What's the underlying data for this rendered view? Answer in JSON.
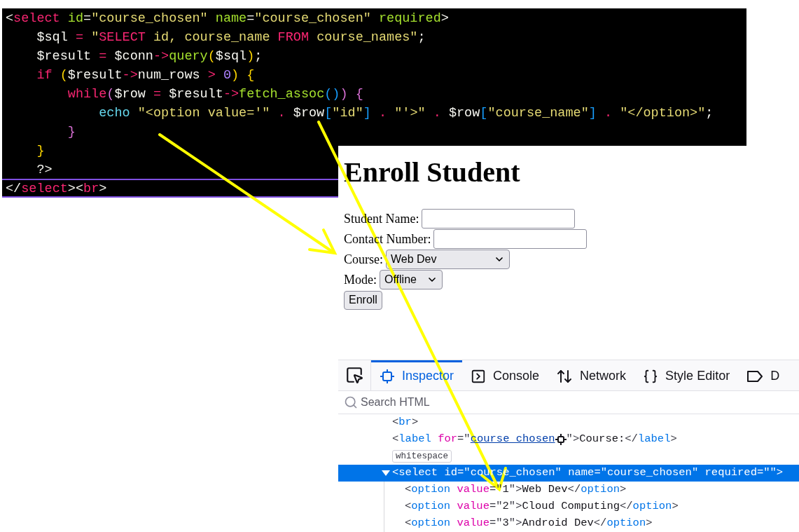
{
  "code_editor": {
    "lines": [
      {
        "current": false,
        "tokens": [
          {
            "kind": "plain",
            "text": "<"
          },
          {
            "kind": "tag",
            "text": "select"
          },
          {
            "kind": "attr",
            "text": " id"
          },
          {
            "kind": "plain",
            "text": "="
          },
          {
            "kind": "string",
            "text": "\"course_chosen\""
          },
          {
            "kind": "attr",
            "text": " name"
          },
          {
            "kind": "plain",
            "text": "="
          },
          {
            "kind": "string",
            "text": "\"course_chosen\""
          },
          {
            "kind": "attr",
            "text": " required"
          },
          {
            "kind": "plain",
            "text": ">"
          }
        ]
      },
      {
        "current": false,
        "tokens": [
          {
            "kind": "plain",
            "text": "    $sql "
          },
          {
            "kind": "op",
            "text": "="
          },
          {
            "kind": "string",
            "text": " \""
          },
          {
            "kind": "keyword",
            "text": "SELECT"
          },
          {
            "kind": "string",
            "text": " id, course_name "
          },
          {
            "kind": "keyword",
            "text": "FROM"
          },
          {
            "kind": "string",
            "text": " course_names\""
          },
          {
            "kind": "plain",
            "text": ";"
          }
        ]
      },
      {
        "current": false,
        "tokens": [
          {
            "kind": "plain",
            "text": "    $result "
          },
          {
            "kind": "op",
            "text": "="
          },
          {
            "kind": "plain",
            "text": " $conn"
          },
          {
            "kind": "op",
            "text": "->"
          },
          {
            "kind": "func",
            "text": "query"
          },
          {
            "kind": "bracket1",
            "text": "("
          },
          {
            "kind": "plain",
            "text": "$sql"
          },
          {
            "kind": "bracket1",
            "text": ")"
          },
          {
            "kind": "plain",
            "text": ";"
          }
        ]
      },
      {
        "current": false,
        "tokens": [
          {
            "kind": "keyword",
            "text": "    if"
          },
          {
            "kind": "bracket1",
            "text": " ("
          },
          {
            "kind": "plain",
            "text": "$result"
          },
          {
            "kind": "op",
            "text": "->"
          },
          {
            "kind": "plain",
            "text": "num_rows "
          },
          {
            "kind": "op",
            "text": ">"
          },
          {
            "kind": "number",
            "text": " 0"
          },
          {
            "kind": "bracket1",
            "text": ")"
          },
          {
            "kind": "bracket1",
            "text": " {"
          }
        ]
      },
      {
        "current": false,
        "tokens": [
          {
            "kind": "keyword",
            "text": "        while"
          },
          {
            "kind": "bracket2",
            "text": "("
          },
          {
            "kind": "plain",
            "text": "$row "
          },
          {
            "kind": "op",
            "text": "="
          },
          {
            "kind": "plain",
            "text": " $result"
          },
          {
            "kind": "op",
            "text": "->"
          },
          {
            "kind": "func",
            "text": "fetch_assoc"
          },
          {
            "kind": "bracket3",
            "text": "()"
          },
          {
            "kind": "bracket2",
            "text": ")"
          },
          {
            "kind": "bracket2",
            "text": " {"
          }
        ]
      },
      {
        "current": false,
        "tokens": [
          {
            "kind": "builtin",
            "text": "            echo"
          },
          {
            "kind": "string",
            "text": " \"<option value='\""
          },
          {
            "kind": "op",
            "text": " ."
          },
          {
            "kind": "plain",
            "text": " $row"
          },
          {
            "kind": "bracket3",
            "text": "["
          },
          {
            "kind": "string",
            "text": "\"id\""
          },
          {
            "kind": "bracket3",
            "text": "]"
          },
          {
            "kind": "op",
            "text": " ."
          },
          {
            "kind": "string",
            "text": " \"'>\""
          },
          {
            "kind": "op",
            "text": " ."
          },
          {
            "kind": "plain",
            "text": " $row"
          },
          {
            "kind": "bracket3",
            "text": "["
          },
          {
            "kind": "string",
            "text": "\"course_name\""
          },
          {
            "kind": "bracket3",
            "text": "]"
          },
          {
            "kind": "op",
            "text": " ."
          },
          {
            "kind": "string",
            "text": " \"</option>\""
          },
          {
            "kind": "plain",
            "text": ";"
          }
        ]
      },
      {
        "current": false,
        "tokens": [
          {
            "kind": "bracket2",
            "text": "        }"
          }
        ]
      },
      {
        "current": false,
        "tokens": [
          {
            "kind": "bracket1",
            "text": "    }"
          }
        ]
      },
      {
        "current": false,
        "tokens": [
          {
            "kind": "plain",
            "text": "    ?>"
          }
        ]
      },
      {
        "current": true,
        "tokens": [
          {
            "kind": "plain",
            "text": "</"
          },
          {
            "kind": "tag",
            "text": "select"
          },
          {
            "kind": "plain",
            "text": "><"
          },
          {
            "kind": "tag",
            "text": "br"
          },
          {
            "kind": "plain",
            "text": ">"
          }
        ]
      }
    ]
  },
  "page": {
    "heading": "Enroll Student",
    "fields": [
      {
        "kind": "text",
        "label": "Student Name:"
      },
      {
        "kind": "text",
        "label": "Contact Number:"
      },
      {
        "kind": "select",
        "label": "Course:",
        "value": "Web Dev"
      },
      {
        "kind": "select",
        "label": "Mode:",
        "value": "Offline"
      }
    ],
    "button": "Enroll"
  },
  "devtools": {
    "tabs": [
      {
        "label": "Inspector",
        "selected": true
      },
      {
        "label": "Console",
        "selected": false
      },
      {
        "label": "Network",
        "selected": false
      },
      {
        "label": "Style Editor",
        "selected": false
      },
      {
        "label": "D",
        "selected": false
      }
    ],
    "search": {
      "placeholder": "Search HTML"
    },
    "nodes": [
      {
        "kind": "element",
        "selected": false,
        "tokens": [
          {
            "kind": "punct",
            "text": "<"
          },
          {
            "kind": "tagname",
            "text": "br"
          },
          {
            "kind": "punct",
            "text": ">"
          }
        ]
      },
      {
        "kind": "element",
        "selected": false,
        "tokens": [
          {
            "kind": "punct",
            "text": "<"
          },
          {
            "kind": "tagname",
            "text": "label"
          },
          {
            "kind": "attrname",
            "text": " for"
          },
          {
            "kind": "punct",
            "text": "=\""
          },
          {
            "kind": "link",
            "text": "course_chosen"
          },
          {
            "kind": "punct",
            "text": "\">"
          },
          {
            "kind": "text",
            "text": "Course:"
          },
          {
            "kind": "punct",
            "text": "</"
          },
          {
            "kind": "tagname",
            "text": "label"
          },
          {
            "kind": "punct",
            "text": ">"
          }
        ]
      },
      {
        "kind": "badge",
        "selected": false,
        "text": "whitespace"
      },
      {
        "kind": "element",
        "selected": true,
        "expanded": true,
        "tokens": [
          {
            "kind": "punct",
            "text": "<"
          },
          {
            "kind": "tagname",
            "text": "select"
          },
          {
            "kind": "attrname",
            "text": " id"
          },
          {
            "kind": "punct",
            "text": "=\""
          },
          {
            "kind": "attrvalue",
            "text": "course_chosen"
          },
          {
            "kind": "punct",
            "text": "\""
          },
          {
            "kind": "attrname",
            "text": " name"
          },
          {
            "kind": "punct",
            "text": "=\""
          },
          {
            "kind": "attrvalue",
            "text": "course_chosen"
          },
          {
            "kind": "punct",
            "text": "\""
          },
          {
            "kind": "attrname",
            "text": " required"
          },
          {
            "kind": "punct",
            "text": "=\"\">"
          }
        ],
        "children": [
          {
            "kind": "element",
            "selected": false,
            "tokens": [
              {
                "kind": "punct",
                "text": "<"
              },
              {
                "kind": "tagname",
                "text": "option"
              },
              {
                "kind": "attrname",
                "text": " value"
              },
              {
                "kind": "punct",
                "text": "=\""
              },
              {
                "kind": "attrvalue",
                "text": "1"
              },
              {
                "kind": "punct",
                "text": "\">"
              },
              {
                "kind": "text",
                "text": "Web Dev"
              },
              {
                "kind": "punct",
                "text": "</"
              },
              {
                "kind": "tagname",
                "text": "option"
              },
              {
                "kind": "punct",
                "text": ">"
              }
            ]
          },
          {
            "kind": "element",
            "selected": false,
            "tokens": [
              {
                "kind": "punct",
                "text": "<"
              },
              {
                "kind": "tagname",
                "text": "option"
              },
              {
                "kind": "attrname",
                "text": " value"
              },
              {
                "kind": "punct",
                "text": "=\""
              },
              {
                "kind": "attrvalue",
                "text": "2"
              },
              {
                "kind": "punct",
                "text": "\">"
              },
              {
                "kind": "text",
                "text": "Cloud Computing"
              },
              {
                "kind": "punct",
                "text": "</"
              },
              {
                "kind": "tagname",
                "text": "option"
              },
              {
                "kind": "punct",
                "text": ">"
              }
            ]
          },
          {
            "kind": "element",
            "selected": false,
            "tokens": [
              {
                "kind": "punct",
                "text": "<"
              },
              {
                "kind": "tagname",
                "text": "option"
              },
              {
                "kind": "attrname",
                "text": " value"
              },
              {
                "kind": "punct",
                "text": "=\""
              },
              {
                "kind": "attrvalue",
                "text": "3"
              },
              {
                "kind": "punct",
                "text": "\">"
              },
              {
                "kind": "text",
                "text": "Android Dev"
              },
              {
                "kind": "punct",
                "text": "</"
              },
              {
                "kind": "tagname",
                "text": "option"
              },
              {
                "kind": "punct",
                "text": ">"
              }
            ]
          }
        ]
      }
    ]
  }
}
